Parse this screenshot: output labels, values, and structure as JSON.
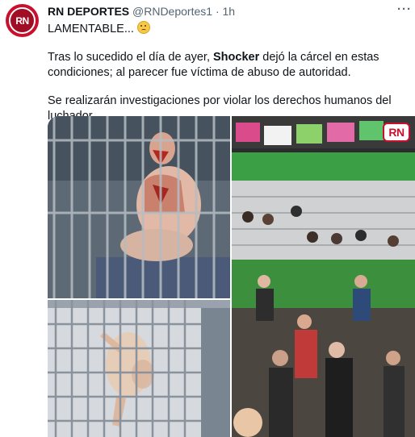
{
  "tweet": {
    "avatar_text": "RN",
    "display_name": "RN DEPORTES",
    "handle": "@RNDeportes1",
    "separator": "·",
    "time": "1h",
    "more_icon": "···",
    "line1": "LAMENTABLE...",
    "emoji": "confused-face",
    "para1_a": "Tras lo sucedido el día de ayer, ",
    "para1_bold": "Shocker",
    "para1_b": " dejó la cárcel en estas condiciones; al parecer fue víctima de abuso de autoridad.",
    "para2": "Se realizarán investigaciones por violar los derechos humanos del luchador."
  },
  "media": {
    "watermark": "RN",
    "colors": {
      "accent": "#c8102e",
      "green_wall": "#3c8f3c",
      "muted": "#536471"
    }
  }
}
